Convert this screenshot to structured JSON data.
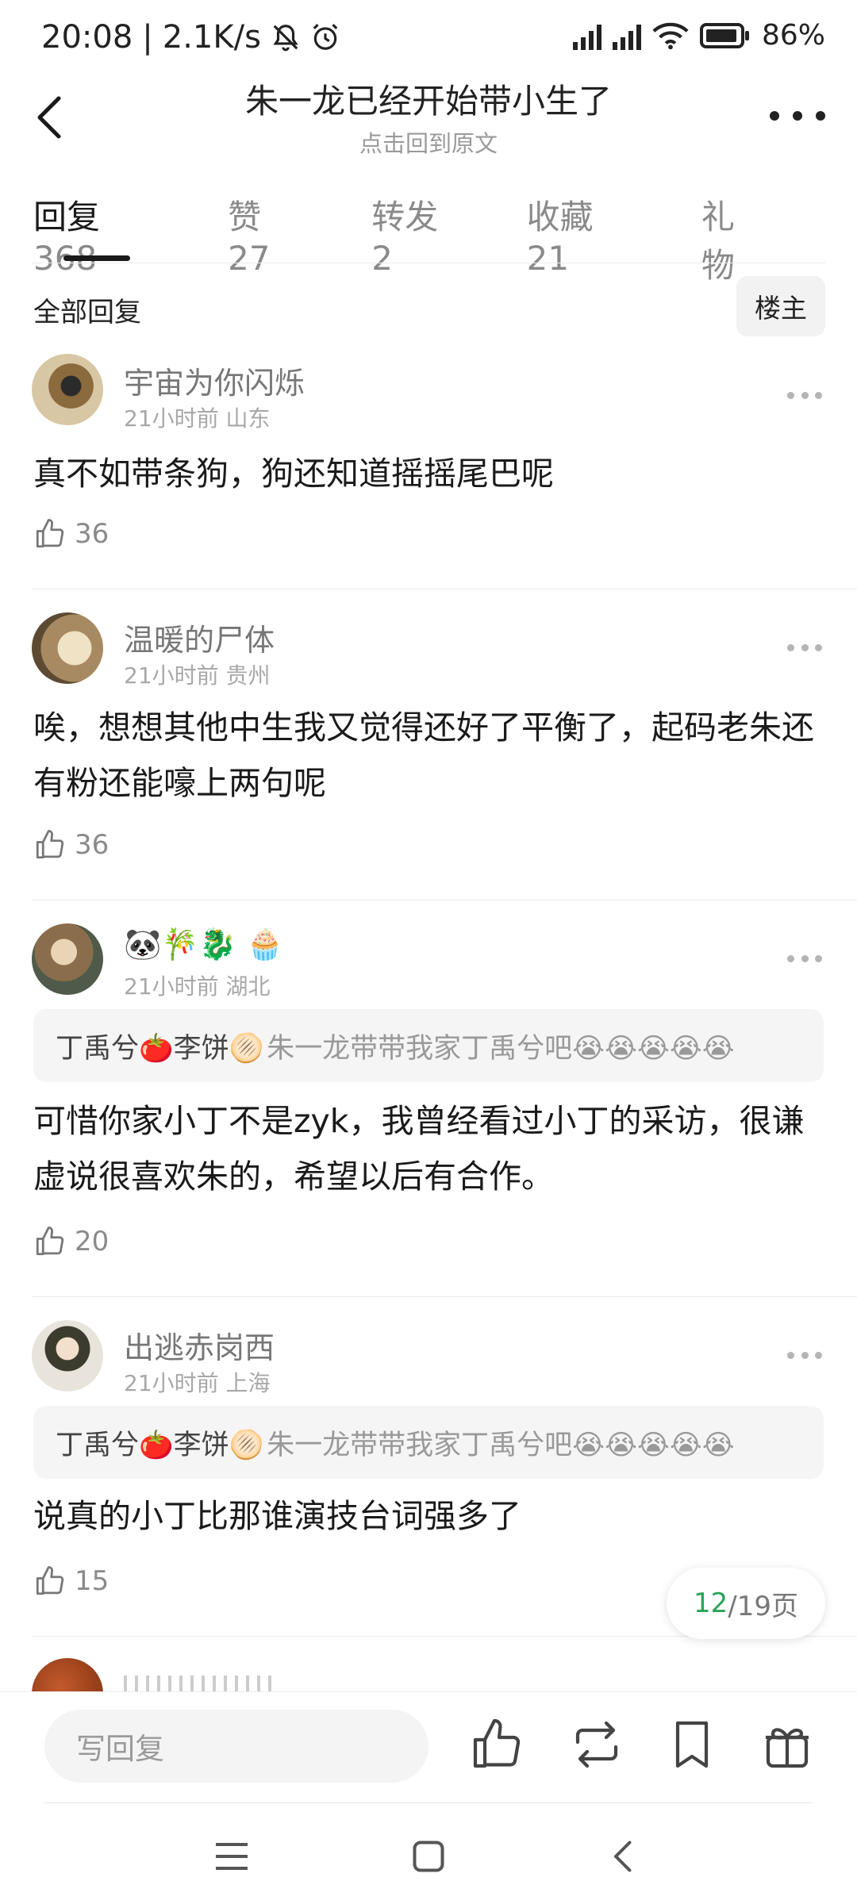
{
  "status_bar": {
    "time": "20:08",
    "net_speed": "2.1K/s",
    "battery": "86%"
  },
  "header": {
    "title": "朱一龙已经开始带小生了",
    "subtitle": "点击回到原文"
  },
  "tabs": [
    {
      "label": "回复",
      "count": "368"
    },
    {
      "label": "赞",
      "count": "27"
    },
    {
      "label": "转发",
      "count": "2"
    },
    {
      "label": "收藏",
      "count": "21"
    },
    {
      "label": "礼物",
      "count": ""
    }
  ],
  "filter": {
    "all_label": "全部回复",
    "owner_label": "楼主"
  },
  "comments": [
    {
      "username": "宇宙为你闪烁",
      "time": "21小时前",
      "location": "山东",
      "text": "真不如带条狗，狗还知道摇摇尾巴呢",
      "likes": "36"
    },
    {
      "username": "温暖的尸体",
      "time": "21小时前",
      "location": "贵州",
      "text": "唉，想想其他中生我又觉得还好了平衡了，起码老朱还有粉还能嚎上两句呢",
      "likes": "36"
    },
    {
      "username": "🐼🎋🐉 🧁",
      "time": "21小时前",
      "location": "湖北",
      "quote_author": "丁禹兮🍅李饼🫓",
      "quote_text": "朱一龙带带我家丁禹兮吧😭😭😭😭😭",
      "text": "可惜你家小丁不是zyk，我曾经看过小丁的采访，很谦虚说很喜欢朱的，希望以后有合作。",
      "likes": "20"
    },
    {
      "username": "出逃赤岗西",
      "time": "21小时前",
      "location": "上海",
      "quote_author": "丁禹兮🍅李饼🫓",
      "quote_text": "朱一龙带带我家丁禹兮吧😭😭😭😭😭",
      "text": "说真的小丁比那谁演技台词强多了",
      "likes": "15"
    }
  ],
  "pagination": {
    "current": "12",
    "total": "/19页"
  },
  "bottom_bar": {
    "reply_placeholder": "写回复"
  },
  "colors": {
    "accent_green": "#2aa35a",
    "text_primary": "#1a1a1a",
    "text_secondary": "#8a8a8a"
  }
}
